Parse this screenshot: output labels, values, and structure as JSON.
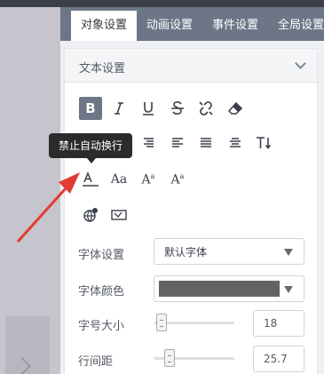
{
  "tabs": [
    {
      "label": "对象设置",
      "active": true
    },
    {
      "label": "动画设置",
      "active": false
    },
    {
      "label": "事件设置",
      "active": false
    },
    {
      "label": "全局设置",
      "active": false
    }
  ],
  "section": {
    "title": "文本设置"
  },
  "toolbar": {
    "bold_glyph": "B",
    "font_size_glyphs": [
      "Aa",
      "A",
      "A"
    ],
    "tooltip": "禁止自动换行"
  },
  "form": {
    "font_label": "字体设置",
    "font_value": "默认字体",
    "color_label": "字体颜色",
    "color_value": "#636363",
    "size_label": "字号大小",
    "size_value": "18",
    "line_label": "行间距",
    "line_value": "25.7"
  },
  "colors": {
    "tab_bar": "#6c7686",
    "active_tab": "#ffffff",
    "annotation_arrow": "#e23b34"
  }
}
